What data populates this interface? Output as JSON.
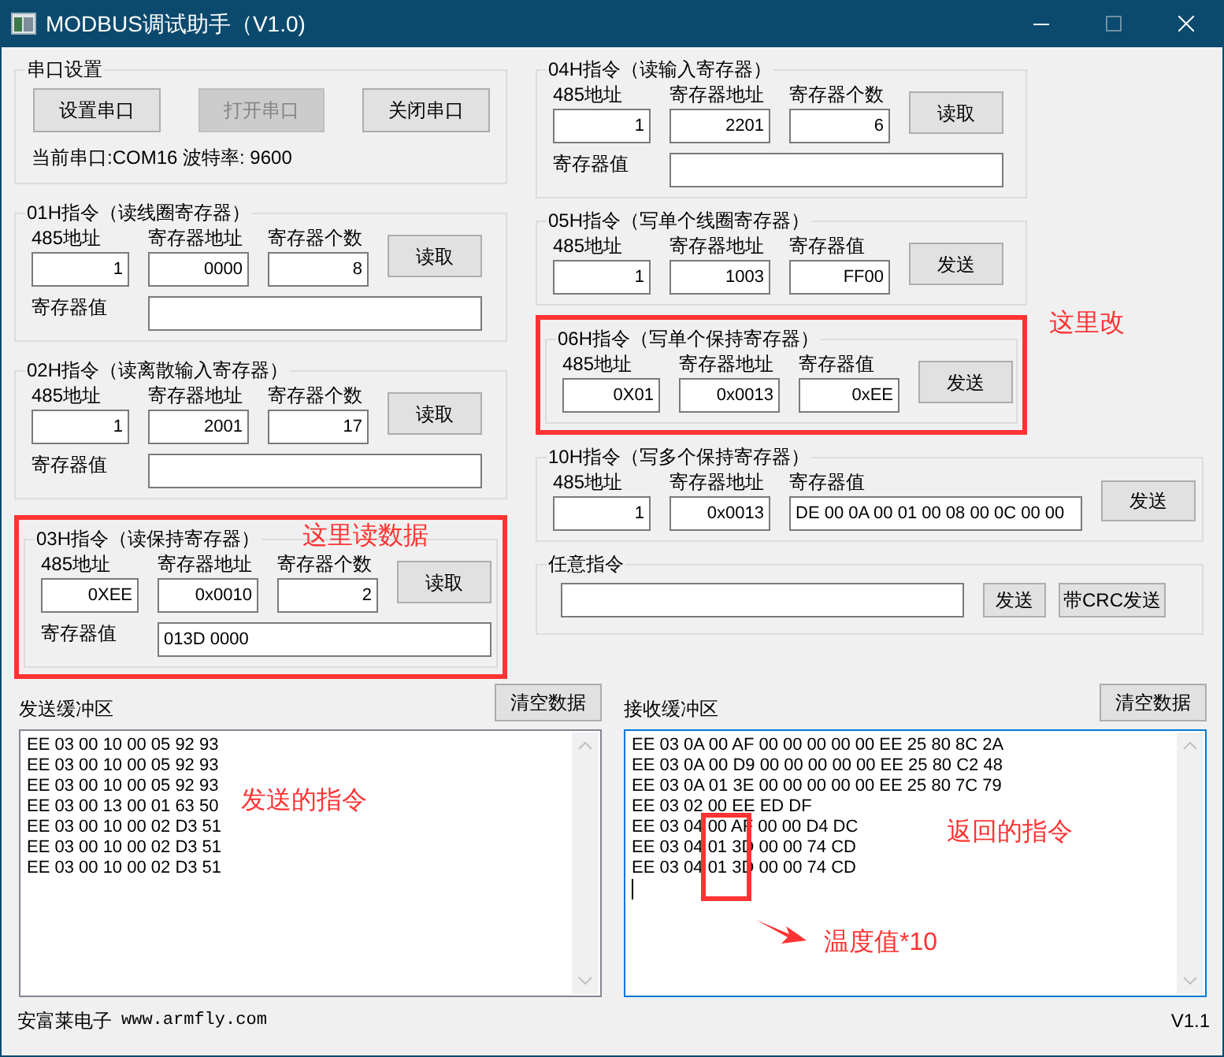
{
  "window": {
    "title": "MODBUS调试助手（V1.0)"
  },
  "left_groups": [
    {
      "kind": "serial",
      "title": "串口设置",
      "highlighted": false,
      "buttons": [
        {
          "label": "设置串口",
          "disabled": false
        },
        {
          "label": "打开串口",
          "disabled": true
        },
        {
          "label": "关闭串口",
          "disabled": false
        }
      ],
      "status": "当前串口:COM16 波特率: 9600"
    },
    {
      "kind": "command",
      "title": "01H指令（读线圈寄存器）",
      "highlighted": false,
      "fields": [
        {
          "label": "485地址",
          "value": "1"
        },
        {
          "label": "寄存器地址",
          "value": "0000"
        },
        {
          "label": "寄存器个数",
          "value": "8"
        }
      ],
      "button": "读取",
      "result": {
        "label": "寄存器值"
      }
    },
    {
      "kind": "command",
      "title": "02H指令（读离散输入寄存器）",
      "highlighted": false,
      "fields": [
        {
          "label": "485地址",
          "value": "1"
        },
        {
          "label": "寄存器地址",
          "value": "2001"
        },
        {
          "label": "寄存器个数",
          "value": "17"
        }
      ],
      "button": "读取",
      "result": {
        "label": "寄存器值"
      }
    },
    {
      "kind": "command",
      "title": "03H指令（读保持寄存器）",
      "highlighted": true,
      "note": "这里读数据",
      "fields": [
        {
          "label": "485地址",
          "value": "0XEE"
        },
        {
          "label": "寄存器地址",
          "value": "0x0010"
        },
        {
          "label": "寄存器个数",
          "value": "2"
        }
      ],
      "button": "读取",
      "result": {
        "label": "寄存器值",
        "value": "013D 0000"
      }
    }
  ],
  "right_groups": [
    {
      "kind": "command",
      "title": "04H指令（读输入寄存器）",
      "highlighted": false,
      "fields": [
        {
          "label": "485地址",
          "value": "1"
        },
        {
          "label": "寄存器地址",
          "value": "2201"
        },
        {
          "label": "寄存器个数",
          "value": "6"
        }
      ],
      "button": "读取",
      "result": {
        "label": "寄存器值"
      }
    },
    {
      "kind": "command",
      "title": "05H指令（写单个线圈寄存器）",
      "highlighted": false,
      "fields": [
        {
          "label": "485地址",
          "value": "1"
        },
        {
          "label": "寄存器地址",
          "value": "1003"
        },
        {
          "label": "寄存器值",
          "value": "FF00"
        }
      ],
      "button": "发送"
    },
    {
      "kind": "command",
      "title": "06H指令（写单个保持寄存器）",
      "highlighted": true,
      "note": "这里改",
      "fields": [
        {
          "label": "485地址",
          "value": "0X01"
        },
        {
          "label": "寄存器地址",
          "value": "0x0013"
        },
        {
          "label": "寄存器值",
          "value": "0xEE"
        }
      ],
      "button": "发送"
    },
    {
      "kind": "multi",
      "title": "10H指令（写多个保持寄存器）",
      "highlighted": false,
      "fields": [
        {
          "label": "485地址",
          "value": "1"
        },
        {
          "label": "寄存器地址",
          "value": "0x0013"
        },
        {
          "label": "寄存器值",
          "value": "DE  00 0A  00 01  00 08  00 0C  00 00"
        }
      ],
      "button": "发送"
    },
    {
      "kind": "free",
      "title": "任意指令",
      "highlighted": false,
      "buttons": [
        {
          "label": "发送",
          "disabled": false
        },
        {
          "label": "带CRC发送",
          "disabled": false
        }
      ]
    }
  ],
  "send_buffer": {
    "label": "发送缓冲区",
    "button": "清空数据",
    "focused": false,
    "note": "发送的指令",
    "lines": [
      "EE 03 00 10 00 05 92 93",
      "EE 03 00 10 00 05 92 93",
      "EE 03 00 10 00 05 92 93",
      "EE 03 00 13 00 01 63 50",
      "EE 03 00 10 00 02 D3 51",
      "EE 03 00 10 00 02 D3 51",
      "EE 03 00 10 00 02 D3 51"
    ]
  },
  "receive_buffer": {
    "label": "接收缓冲区",
    "button": "清空数据",
    "focused": true,
    "notes": [
      "返回的指令",
      "温度值*10"
    ],
    "lines": [
      "EE 03 0A 00 AF 00 00 00 00 00 EE 25 80 8C 2A",
      "EE 03 0A 00 D9 00 00 00 00 00 EE 25 80 C2 48",
      "EE 03 0A 01 3E 00 00 00 00 00 EE 25 80 7C 79",
      "EE 03 02 00 EE ED DF",
      "EE 03 04 00 AF 00 00 D4 DC",
      "EE 03 04 01 3D 00 00 74 CD",
      "EE 03 04 01 3D 00 00 74 CD"
    ]
  },
  "status_bar": {
    "company": "安富莱电子",
    "url": "www.armfly.com",
    "version": "V1.1"
  }
}
